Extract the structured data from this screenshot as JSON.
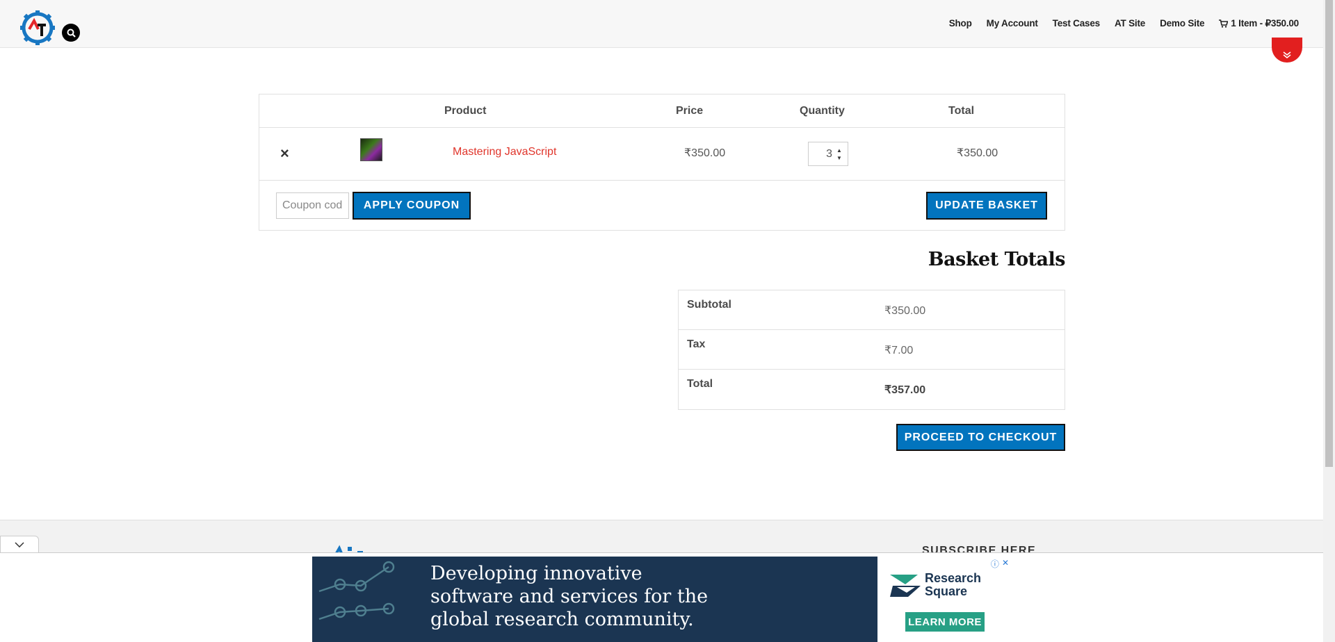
{
  "header": {
    "nav": [
      "Shop",
      "My Account",
      "Test Cases",
      "AT Site",
      "Demo Site"
    ],
    "cart_summary": "1 Item - ₽350.00"
  },
  "cart": {
    "columns": [
      "Product",
      "Price",
      "Quantity",
      "Total"
    ],
    "item": {
      "remove": "×",
      "name": "Mastering JavaScript",
      "price": "₹350.00",
      "quantity": "3",
      "total": "₹350.00"
    },
    "coupon_placeholder": "Coupon code",
    "apply_label": "APPLY COUPON",
    "update_label": "UPDATE BASKET"
  },
  "totals": {
    "title": "Basket Totals",
    "rows": [
      {
        "label": "Subtotal",
        "value": "₹350.00"
      },
      {
        "label": "Tax",
        "value": "₹7.00"
      },
      {
        "label": "Total",
        "value": "₹357.00"
      }
    ],
    "checkout_label": "PROCEED TO CHECKOUT"
  },
  "footer": {
    "subscribe_heading": "SUBSCRIBE HERE"
  },
  "ad": {
    "headline": [
      "Developing innovative",
      "software and services for the",
      "global research community."
    ],
    "brand": [
      "Research",
      "Square"
    ],
    "cta": "LEARN MORE",
    "choices": [
      "ⓘ",
      "✕"
    ]
  },
  "colors": {
    "accent_button": "#0274be",
    "link_red": "#e0352b",
    "ad_navy": "#1b3552",
    "ad_cta_green": "#27a085",
    "scroll_top_red": "#e21f1f"
  }
}
